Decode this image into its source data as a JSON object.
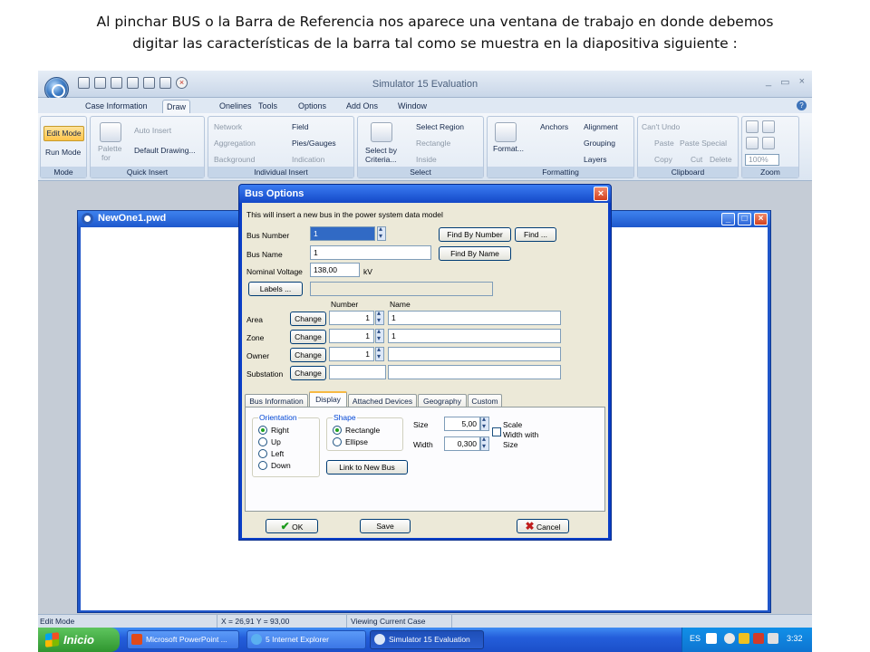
{
  "caption": {
    "line1": "Al pinchar BUS o la Barra de Referencia nos aparece una ventana de trabajo en donde debemos",
    "line2": "digitar las características de la barra tal como se muestra en la diapositiva siguiente :"
  },
  "app": {
    "title": "Simulator 15 Evaluation",
    "window_controls": [
      "_",
      "▭",
      "×"
    ]
  },
  "ribbon_tabs": [
    "Case Information",
    "Draw",
    "Onelines",
    "Tools",
    "Options",
    "Add Ons",
    "Window"
  ],
  "ribbon": {
    "mode": {
      "edit": "Edit Mode",
      "run": "Run Mode",
      "label": "Mode"
    },
    "quick_insert": {
      "palette": "Palette",
      "palette_for": "for",
      "auto_insert": "Auto Insert",
      "default_drawing": "Default Drawing...",
      "label": "Quick Insert"
    },
    "individual_insert": {
      "network": "Network",
      "aggregation": "Aggregation",
      "background": "Background",
      "field": "Field",
      "pies_gauges": "Pies/Gauges",
      "indication": "Indication",
      "label": "Individual Insert"
    },
    "select": {
      "select_by": "Select by",
      "criteria": "Criteria...",
      "select_region": "Select Region",
      "rectangle": "Rectangle",
      "inside": "Inside",
      "label": "Select"
    },
    "formatting": {
      "format": "Format...",
      "anchors": "Anchors",
      "alignment": "Alignment",
      "grouping": "Grouping",
      "layers": "Layers",
      "label": "Formatting"
    },
    "clipboard": {
      "cant_undo": "Can't Undo",
      "paste": "Paste",
      "paste_special": "Paste Special",
      "copy": "Copy",
      "cut": "Cut",
      "delete": "Delete",
      "label": "Clipboard"
    },
    "zoom": {
      "level": "100%",
      "label": "Zoom"
    }
  },
  "document": {
    "title": "NewOne1.pwd"
  },
  "dialog": {
    "title": "Bus Options",
    "info": "This will insert a new bus in the power system data model",
    "bus_number_label": "Bus Number",
    "bus_number_value": "1",
    "find_by_number": "Find By Number",
    "find": "Find ...",
    "bus_name_label": "Bus Name",
    "bus_name_value": "1",
    "find_by_name": "Find By Name",
    "nominal_voltage_label": "Nominal Voltage",
    "nominal_voltage_value": "138,00",
    "nominal_voltage_unit": "kV",
    "labels_button": "Labels ...",
    "col_number": "Number",
    "col_name": "Name",
    "change": "Change",
    "rows": [
      {
        "label": "Area",
        "number": "1",
        "name": "1"
      },
      {
        "label": "Zone",
        "number": "1",
        "name": "1"
      },
      {
        "label": "Owner",
        "number": "1",
        "name": ""
      },
      {
        "label": "Substation",
        "number": "",
        "name": ""
      }
    ],
    "tabs": [
      "Bus Information",
      "Display",
      "Attached Devices",
      "Geography",
      "Custom"
    ],
    "orientation": {
      "legend": "Orientation",
      "options": [
        "Right",
        "Up",
        "Left",
        "Down"
      ],
      "selected": "Right"
    },
    "shape": {
      "legend": "Shape",
      "options": [
        "Rectangle",
        "Ellipse"
      ],
      "selected": "Rectangle"
    },
    "size_label": "Size",
    "size_value": "5,00",
    "width_label": "Width",
    "width_value": "0,300",
    "scale_label": "Scale",
    "scale_label2": "Width with",
    "scale_label3": "Size",
    "link_button": "Link to New Bus",
    "ok": "OK",
    "save": "Save",
    "cancel": "Cancel"
  },
  "status": {
    "mode": "Edit Mode",
    "coords": "X = 26,91 Y = 93,00",
    "viewing": "Viewing Current Case"
  },
  "taskbar": {
    "start": "Inicio",
    "tasks": [
      "Microsoft PowerPoint ...",
      "5 Internet Explorer",
      "Simulator 15 Evaluation"
    ],
    "lang": "ES",
    "clock": "3:32"
  },
  "colors": {
    "accent": "#0a3ec6",
    "ribbon": "#dbe5f1",
    "edit_mode": "#ffc54a"
  }
}
